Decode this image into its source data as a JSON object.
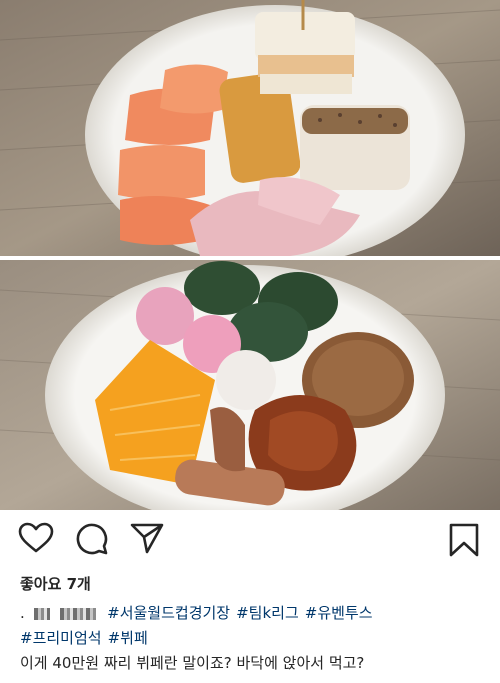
{
  "post": {
    "photos": [
      {
        "name": "buffet-plate-1",
        "contents": [
          "smoked salmon",
          "fried tofu",
          "sandwich",
          "ham slices",
          "rice cake roll"
        ]
      },
      {
        "name": "buffet-plate-2",
        "contents": [
          "green rice cakes",
          "pink rice cakes",
          "white rice cake",
          "orange slices",
          "patty",
          "fried chicken",
          "fried dough"
        ]
      }
    ],
    "actions": {
      "like_icon": "heart-icon",
      "comment_icon": "comment-icon",
      "share_icon": "paper-plane-icon",
      "save_icon": "bookmark-icon"
    },
    "likes_label": "좋아요 7개",
    "caption": {
      "username_prefix": ".",
      "hashtags_line1": [
        "#서울월드컵경기장",
        "#팀k리그",
        "#유벤투스"
      ],
      "hashtags_line2": [
        "#프리미엄석",
        "#뷔페"
      ],
      "text": "이게 40만원 짜리 뷔페란 말이죠? 바닥에 앉아서 먹고?"
    },
    "colors": {
      "text": "#262626",
      "hashtag": "#00376b"
    }
  }
}
